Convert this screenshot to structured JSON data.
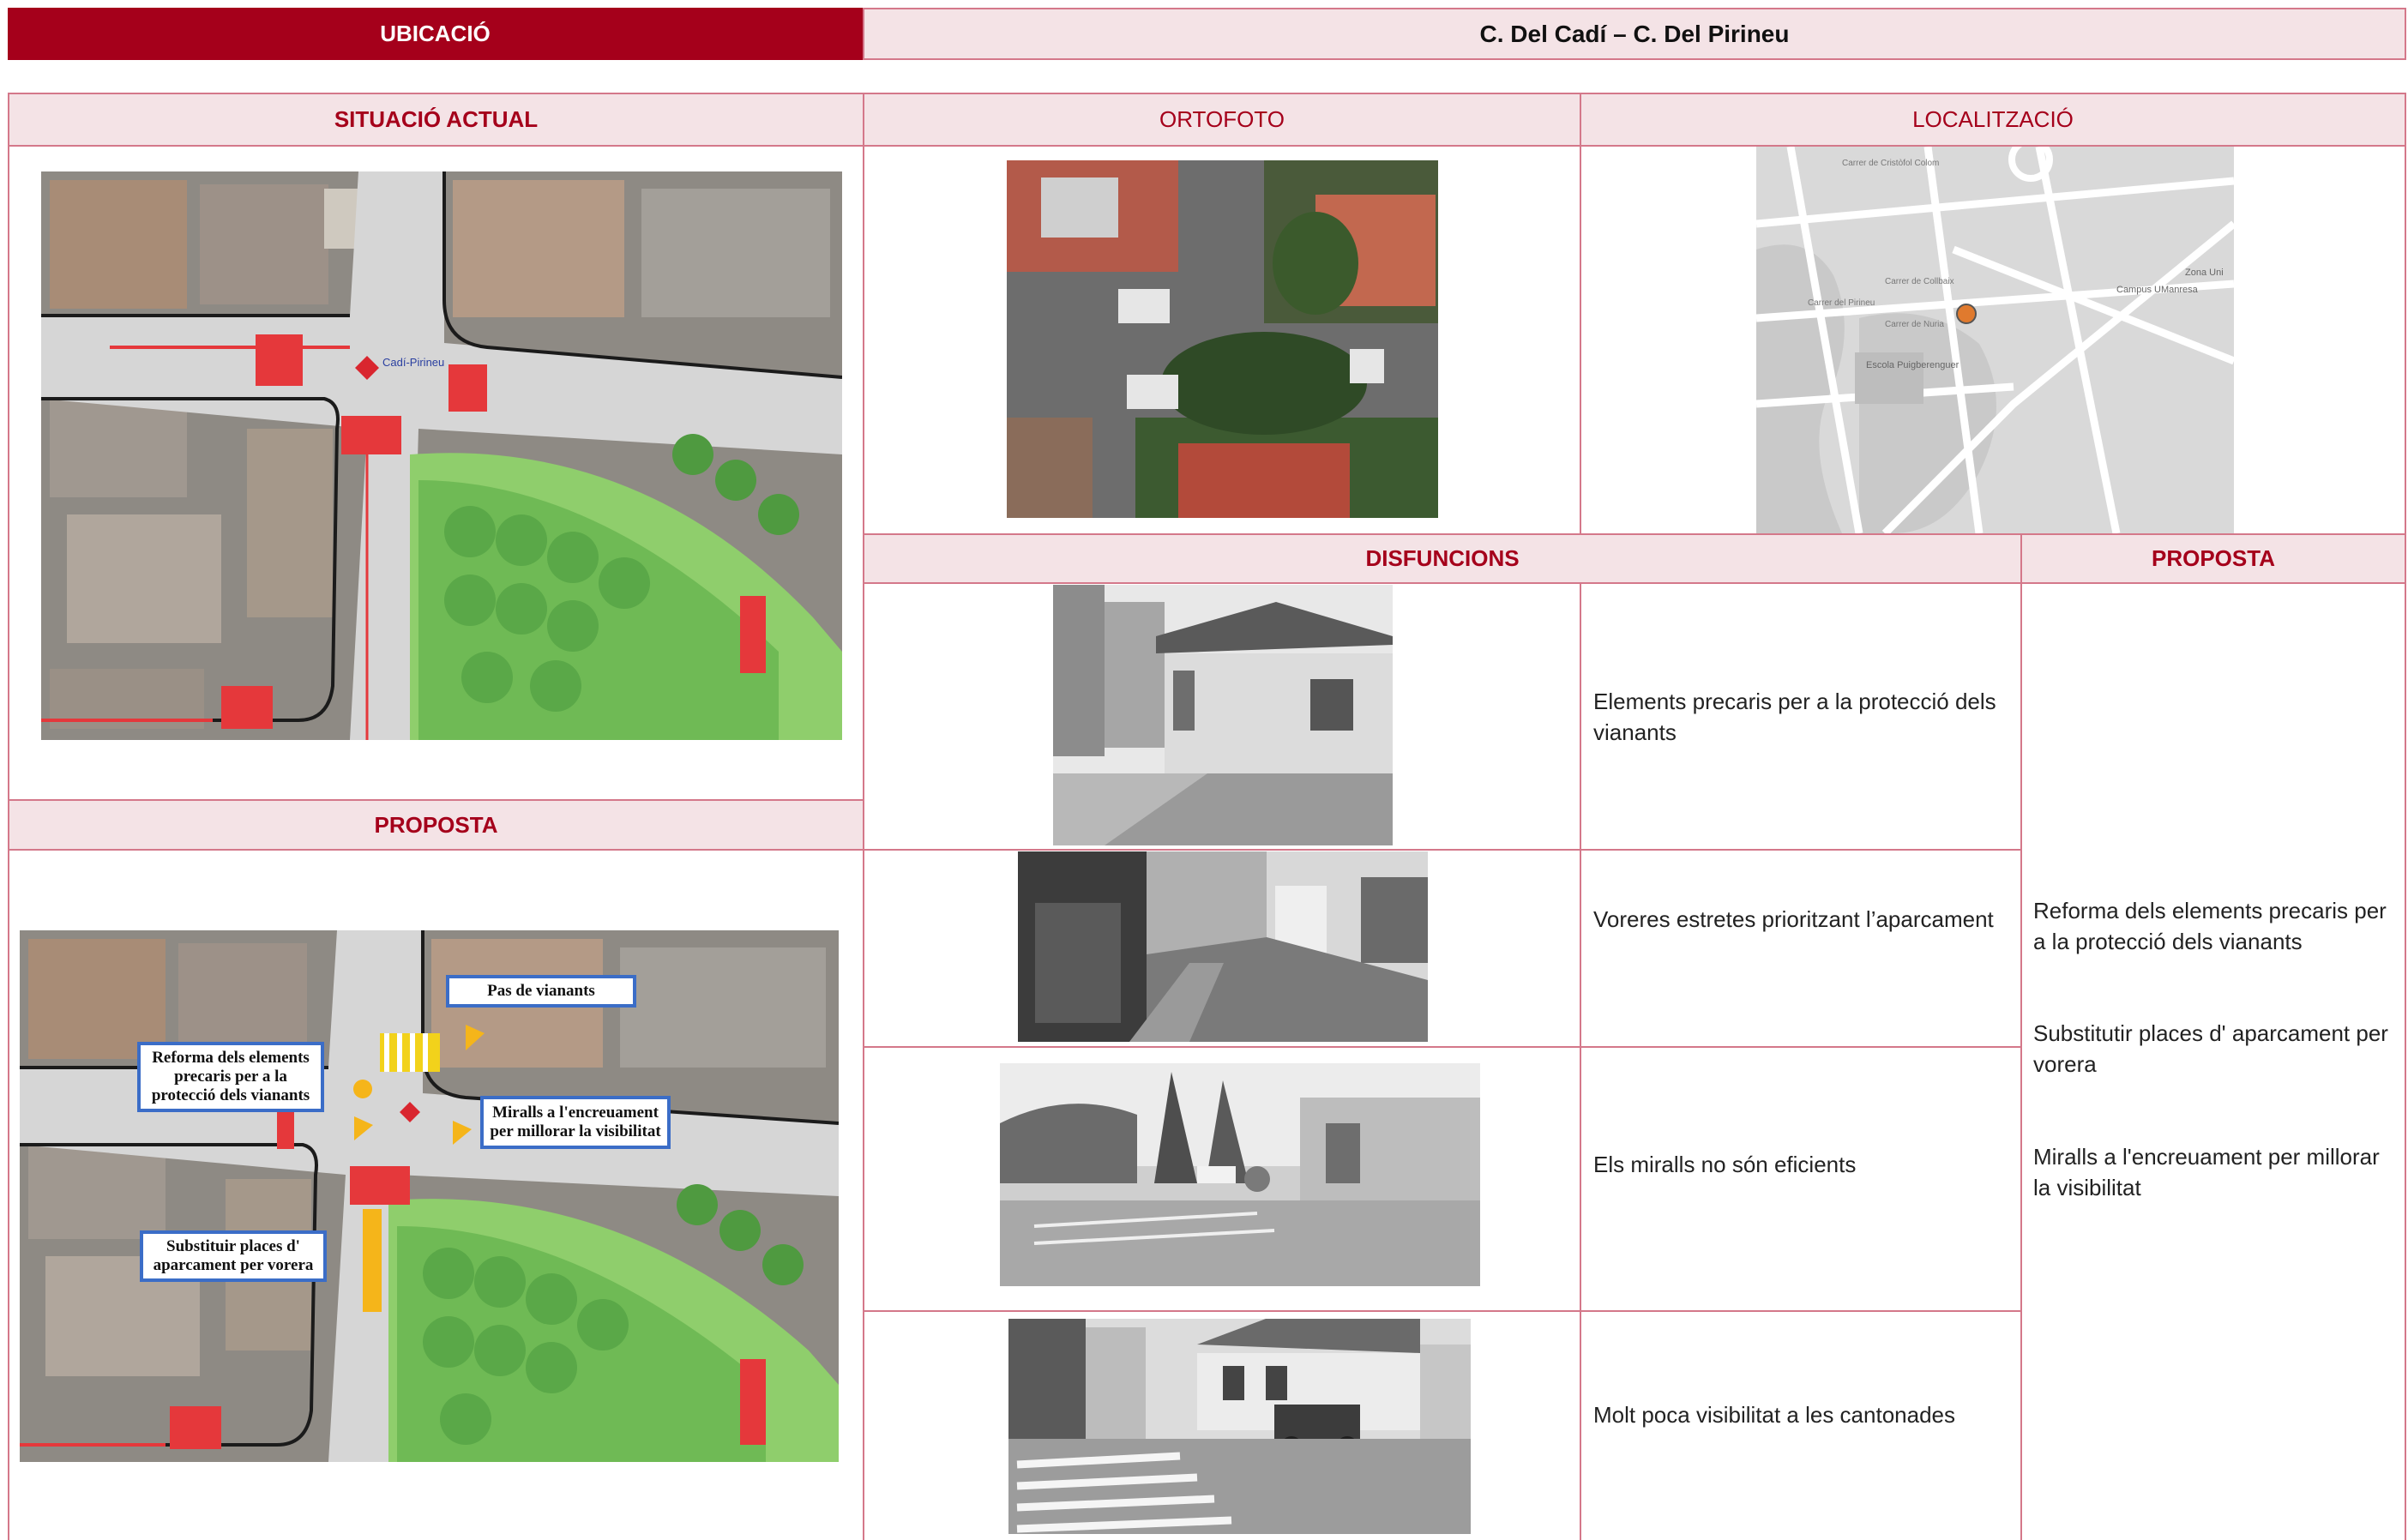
{
  "header": {
    "left_label": "UBICACIÓ",
    "title": "C. Del Cadí – C. Del Pirineu"
  },
  "sections": {
    "situacio_actual": "SITUACIÓ ACTUAL",
    "ortofoto": "ORTOFOTO",
    "localitzacio": "LOCALITZACIÓ",
    "proposta_left": "PROPOSTA",
    "disfuncions": "DISFUNCIONS",
    "proposta_right": "PROPOSTA"
  },
  "plan_label": "Cadí-Pirineu",
  "callouts": {
    "pas_vianants": "Pas de vianants",
    "reforma": "Reforma dels elements precaris per a la protecció dels vianants",
    "miralls": "Miralls a l'encreuament per millorar la visibilitat",
    "substituir": "Substituir places d' aparcament per vorera"
  },
  "map_labels": {
    "escola": "Escola Puigberenguer",
    "campus": "Campus UManresa",
    "zona": "Zona Uni",
    "street1": "Carrer de Cristòfol Colom",
    "street2": "Carrer de Collbaix",
    "street3": "Carrer del Pirineu",
    "street4": "Carrer de Nuria"
  },
  "disfuncions": [
    {
      "text": "Elements precaris per a la protecció dels vianants"
    },
    {
      "text": "Voreres estretes prioritzant l’aparcament"
    },
    {
      "text": "Els miralls no són eficients"
    },
    {
      "text": "Molt poca visibilitat a les cantonades"
    }
  ],
  "proposta_items": [
    "Reforma dels elements precaris per a la protecció dels vianants",
    "Substitutir places d' aparcament per vorera",
    "Miralls a l'encreuament per millorar la visibilitat"
  ],
  "colors": {
    "brand_red": "#a5001b",
    "band_bg": "#f4e3e6",
    "border": "#d4788a",
    "callout_blue": "#3b6dc7"
  }
}
